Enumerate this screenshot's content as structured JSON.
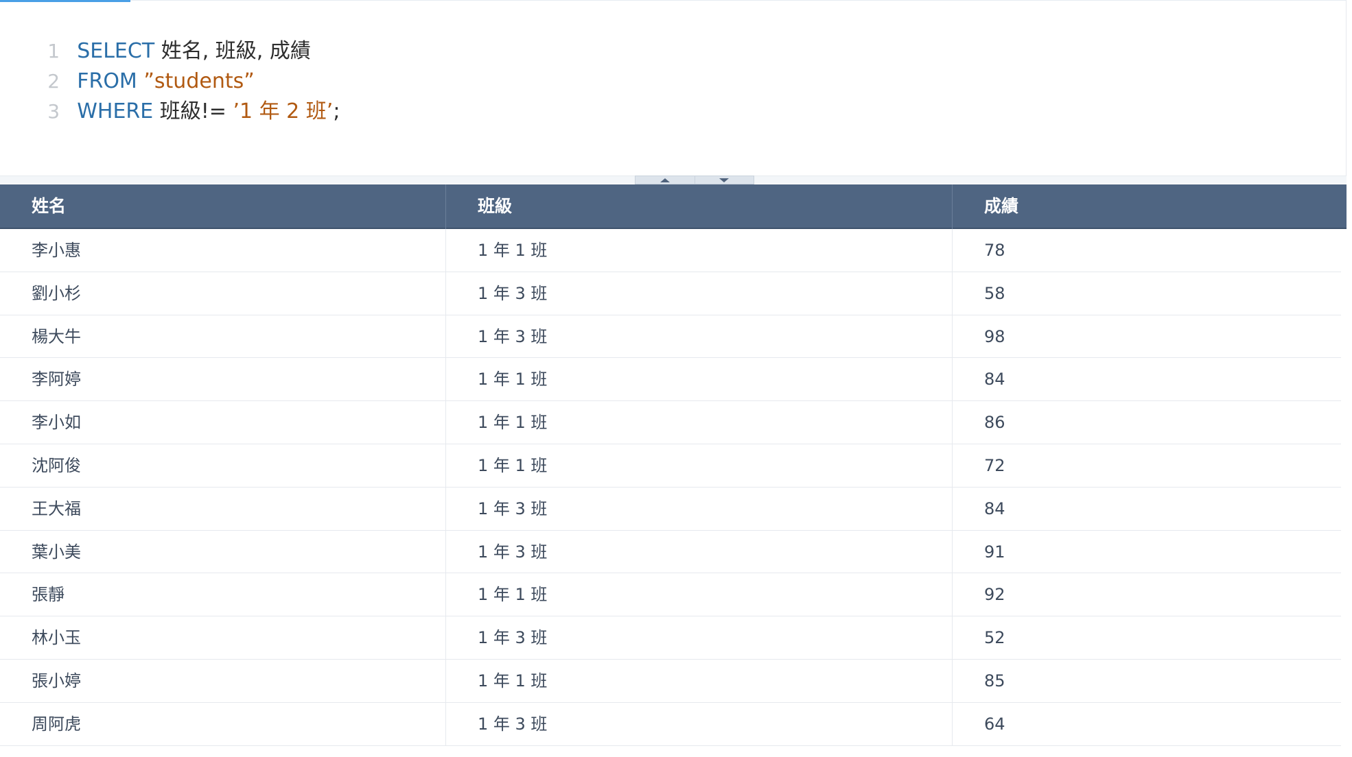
{
  "editor": {
    "lines": [
      {
        "num": "1",
        "kw": "SELECT",
        "rest": " 姓名, 班級, 成績"
      },
      {
        "num": "2",
        "kw": "FROM",
        "str": " ”students”"
      },
      {
        "num": "3",
        "kw": "WHERE",
        "rest": " 班級!= ",
        "str": "’1 年 2 班’",
        "tail": ";"
      }
    ]
  },
  "splitter": {
    "up_icon": "triangle-up-icon",
    "down_icon": "triangle-down-icon"
  },
  "table": {
    "headers": [
      "姓名",
      "班級",
      "成績"
    ],
    "rows": [
      [
        "李小惠",
        "1 年 1 班",
        "78"
      ],
      [
        "劉小杉",
        "1 年 3 班",
        "58"
      ],
      [
        "楊大牛",
        "1 年 3 班",
        "98"
      ],
      [
        "李阿婷",
        "1 年 1 班",
        "84"
      ],
      [
        "李小如",
        "1 年 1 班",
        "86"
      ],
      [
        "沈阿俊",
        "1 年 1 班",
        "72"
      ],
      [
        "王大福",
        "1 年 3 班",
        "84"
      ],
      [
        "葉小美",
        "1 年 3 班",
        "91"
      ],
      [
        "張靜",
        "1 年 1 班",
        "92"
      ],
      [
        "林小玉",
        "1 年 3 班",
        "52"
      ],
      [
        "張小婷",
        "1 年 1 班",
        "85"
      ],
      [
        "周阿虎",
        "1 年 3 班",
        "64"
      ]
    ]
  },
  "colors": {
    "header_bg": "#4f6582",
    "keyword": "#2a6ea8",
    "string": "#b15a12",
    "progress": "#4a9fe6"
  }
}
